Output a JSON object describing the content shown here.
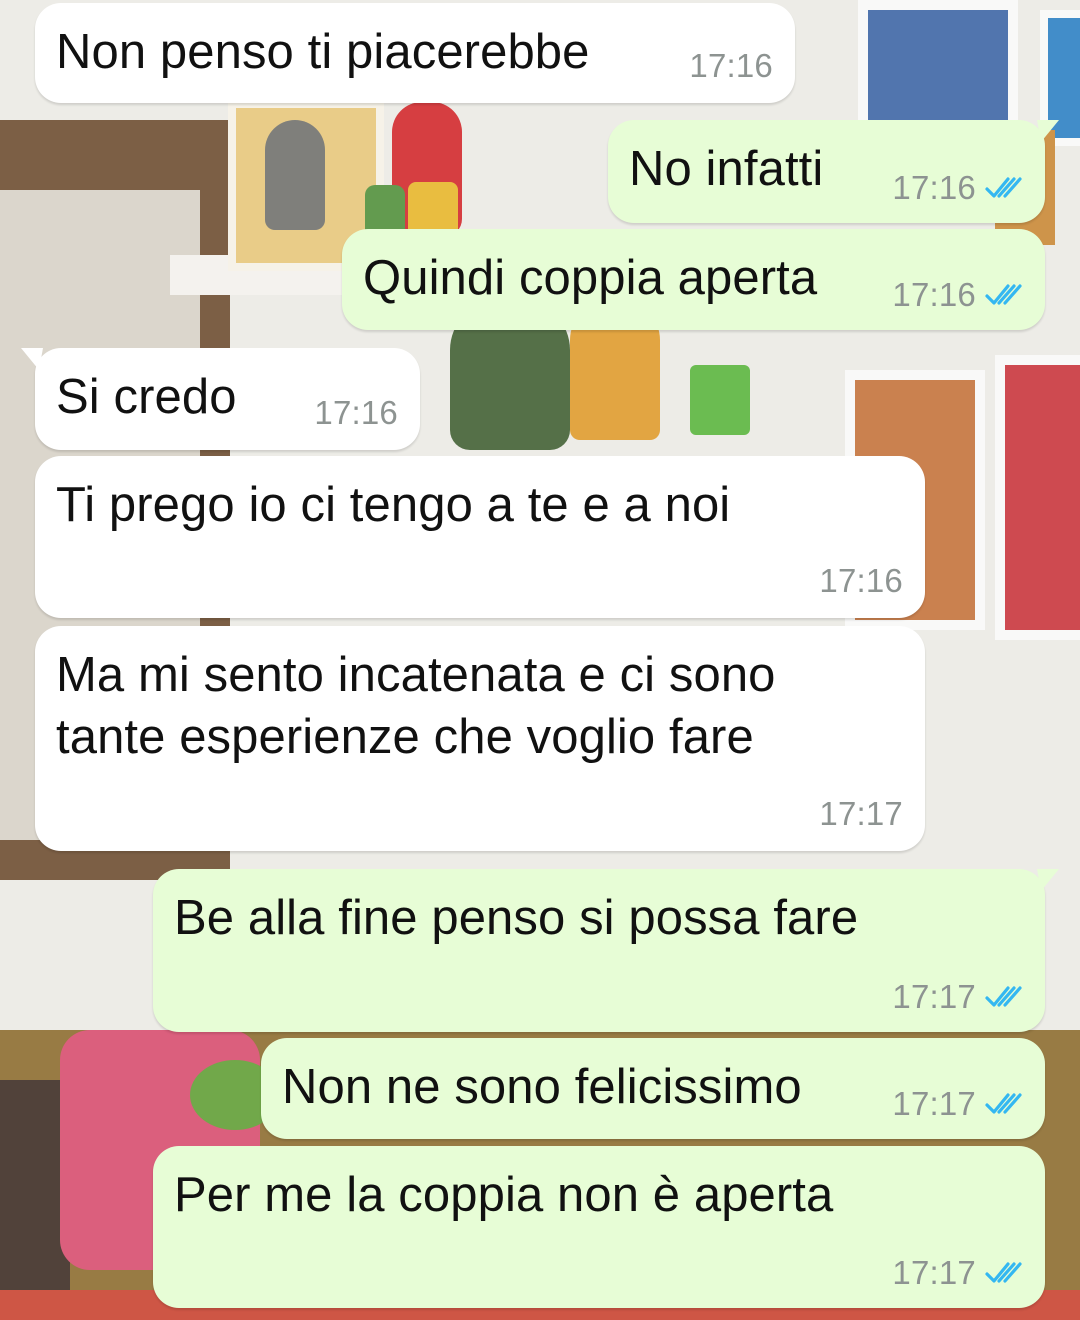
{
  "chat": {
    "messages": [
      {
        "id": "m1",
        "direction": "in",
        "text": "Non penso ti piacerebbe",
        "time": "17:16"
      },
      {
        "id": "m2",
        "direction": "out",
        "text": "No infatti",
        "time": "17:16",
        "status": "read"
      },
      {
        "id": "m3",
        "direction": "out",
        "text": "Quindi coppia aperta",
        "time": "17:16",
        "status": "read"
      },
      {
        "id": "m4",
        "direction": "in",
        "text": "Si credo",
        "time": "17:16"
      },
      {
        "id": "m5",
        "direction": "in",
        "text": "Ti prego io ci tengo a te e a noi",
        "time": "17:16"
      },
      {
        "id": "m6",
        "direction": "in",
        "text": "Ma mi sento incatenata e ci sono\ntante esperienze che voglio fare",
        "time": "17:17"
      },
      {
        "id": "m7",
        "direction": "out",
        "text": "Be alla fine penso si possa fare",
        "time": "17:17",
        "status": "read"
      },
      {
        "id": "m8",
        "direction": "out",
        "text": "Non ne sono felicissimo",
        "time": "17:17",
        "status": "read"
      },
      {
        "id": "m9",
        "direction": "out",
        "text": "Per me la coppia non è aperta",
        "time": "17:17",
        "status": "read"
      }
    ]
  },
  "colors": {
    "incoming_bubble": "#ffffff",
    "outgoing_bubble": "#e7fdd6",
    "timestamp": "#8d9391",
    "read_ticks": "#34b7f1"
  },
  "icons": {
    "read_status": "double-check-icon"
  }
}
